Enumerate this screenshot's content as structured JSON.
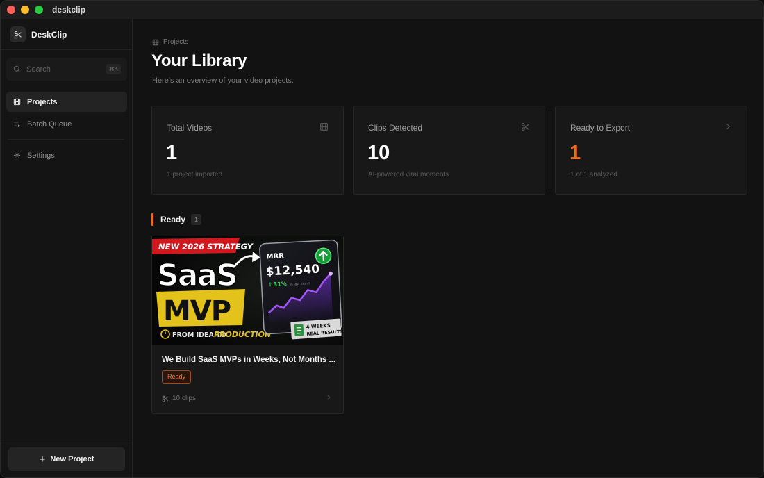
{
  "window": {
    "title": "deskclip"
  },
  "sidebar": {
    "brand": "DeskClip",
    "search": {
      "placeholder": "Search",
      "shortcut": "⌘K"
    },
    "items": [
      {
        "label": "Projects",
        "icon": "film-icon",
        "active": true
      },
      {
        "label": "Batch Queue",
        "icon": "list-icon",
        "active": false
      },
      {
        "label": "Settings",
        "icon": "gear-icon",
        "active": false
      }
    ],
    "new_project_label": "New Project"
  },
  "main": {
    "breadcrumb": "Projects",
    "title": "Your Library",
    "subtitle": "Here's an overview of your video projects.",
    "stats": [
      {
        "label": "Total Videos",
        "value": "1",
        "note": "1 project imported",
        "icon": "film-icon"
      },
      {
        "label": "Clips Detected",
        "value": "10",
        "note": "AI-powered viral moments",
        "icon": "scissors-icon"
      },
      {
        "label": "Ready to Export",
        "value": "1",
        "note": "1 of 1 analyzed",
        "icon": "chevron-right-icon"
      }
    ],
    "section": {
      "title": "Ready",
      "count": "1"
    },
    "projects": [
      {
        "title": "We Build SaaS MVPs in Weeks, Not Months ...",
        "status": "Ready",
        "clips": "10 clips",
        "thumbnail": {
          "banner": "NEW 2026 STRATEGY",
          "word1": "SaaS",
          "word2": "MVP",
          "tagline_a": "FROM IDEA TO",
          "tagline_b": "PRODUCTION",
          "metric_label": "MRR",
          "metric_value": "$12,540",
          "metric_change": "31%",
          "metric_change_note": "vs last month",
          "sticker_a": "4 WEEKS",
          "sticker_b": "REAL RESULTS"
        }
      }
    ]
  },
  "colors": {
    "accent": "#f26a1b",
    "background": "#121212",
    "card": "#181818",
    "badge_text": "#f27a35"
  }
}
